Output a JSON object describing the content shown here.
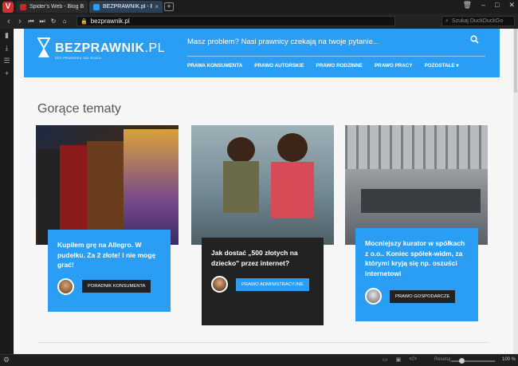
{
  "browser": {
    "tabs": [
      {
        "label": "Spider's Web - Blog Blisko",
        "active": false
      },
      {
        "label": "BEZPRAWNIK.pl - Bez prawn",
        "active": true
      }
    ],
    "url": "bezprawnik.pl",
    "search_placeholder": "Szukaj DuckDuckGo",
    "status": {
      "reset_label": "Resetuj",
      "zoom_level": "100 %",
      "zoom_fraction": 0.2
    }
  },
  "site": {
    "logo_main": "BEZPRAWNIK",
    "logo_suffix": ".PL",
    "logo_tagline": "BEZ PRAWNIKA JAK RUDZI",
    "tagline": "Masz problem? Nasi prawnicy czekają na twoje pytanie...",
    "nav": [
      "PRAWA KONSUMENTA",
      "PRAWO AUTORSKIE",
      "PRAWO RODZINNE",
      "PRAWO PRACY",
      "POZOSTAŁE ▾"
    ],
    "section_title": "Gorące tematy"
  },
  "cards": [
    {
      "title": "Kupiłem grę na Allegro. W pudełku. Za 2 złote! I nie mogę grać!",
      "category": "PORADNIK KONSUMENTA",
      "box_color": "#2a9df4",
      "button_color": "#222222",
      "title_color": "#ffffff"
    },
    {
      "title": "Jak dostać „500 złotych na dziecko\" przez internet?",
      "category": "PRAWO ADMINISTRACYJNE",
      "box_color": "#222222",
      "button_color": "#2a9df4",
      "title_color": "#ffffff"
    },
    {
      "title": "Mocniejszy kurator w spółkach z o.o.. Koniec spółek-widm, za którymi kryją się np. oszuści internetowi",
      "category": "PRAWO GOSPODARCZE",
      "box_color": "#2a9df4",
      "button_color": "#222222",
      "title_color": "#ffffff"
    }
  ],
  "images": {
    "card1": "game-boxes-photo",
    "card2": "children-photo",
    "card3": "office-photo"
  },
  "colors": {
    "brand": "#2a9df4",
    "dark": "#222222",
    "page_bg": "#f6f6f6"
  }
}
